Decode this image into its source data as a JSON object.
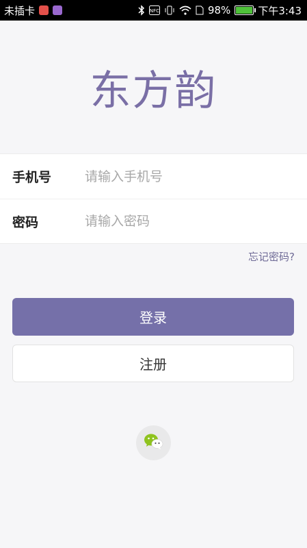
{
  "status_bar": {
    "carrier": "未插卡",
    "signal_badge": "NFC",
    "battery_percent": "98%",
    "battery_level": 0.98,
    "time": "下午3:43",
    "icons": [
      "app-notification-icon",
      "app-notification-icon",
      "bluetooth-icon",
      "nfc-icon",
      "vibrate-icon",
      "wifi-icon",
      "sim-icon",
      "battery-icon"
    ]
  },
  "app": {
    "logo_text": "东方韵"
  },
  "login_form": {
    "phone_label": "手机号",
    "phone_placeholder": "请输入手机号",
    "phone_value": "",
    "password_label": "密码",
    "password_placeholder": "请输入密码",
    "password_value": "",
    "forgot_password": "忘记密码?"
  },
  "actions": {
    "login_label": "登录",
    "register_label": "注册"
  },
  "social_login": {
    "wechat_icon": "wechat-icon"
  },
  "colors": {
    "accent": "#7570a9",
    "logo": "#7a6fa6",
    "background": "#f6f6f8",
    "link": "#6e6a96"
  }
}
